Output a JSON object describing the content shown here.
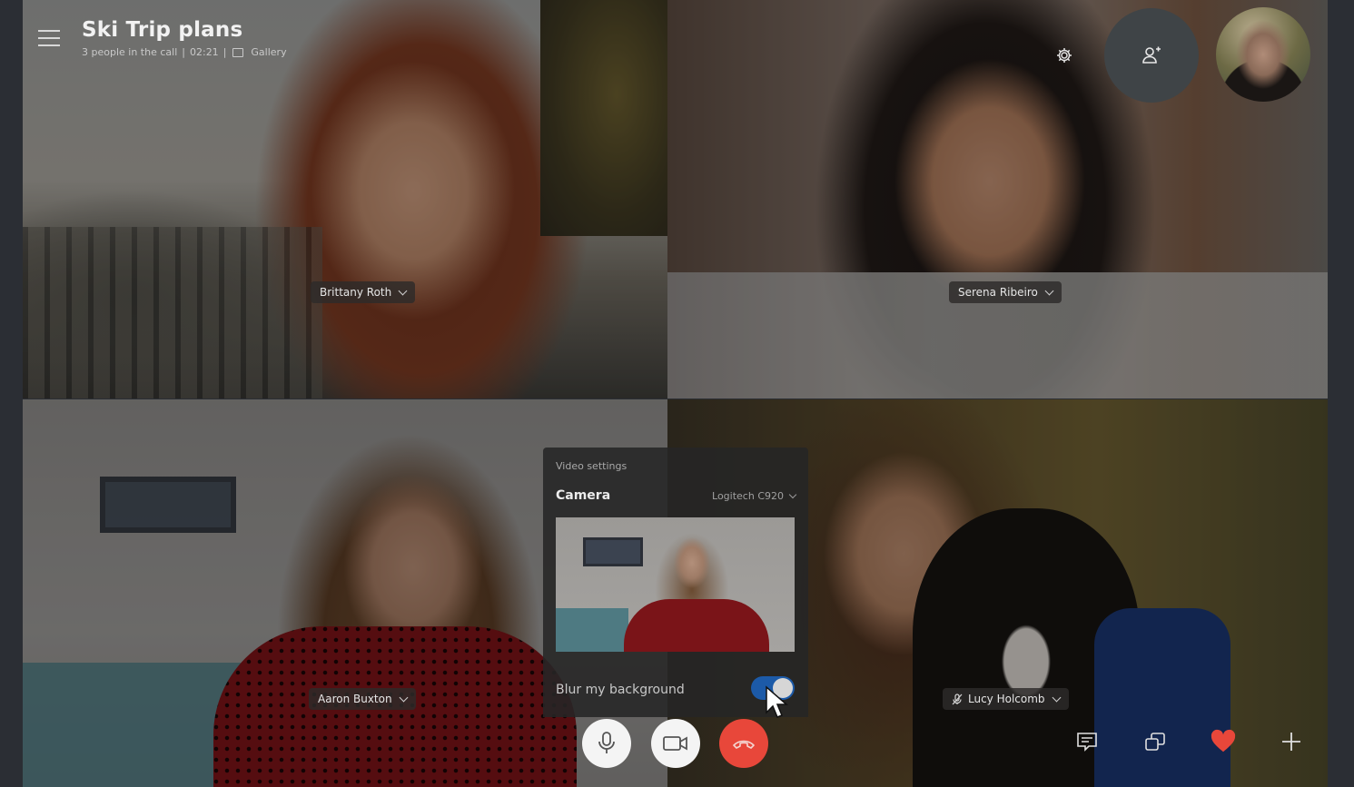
{
  "header": {
    "title": "Ski Trip plans",
    "participants": "3 people in the call",
    "separator": "|",
    "duration": "02:21",
    "view_mode": "Gallery",
    "menu_icon": "hamburger-menu-icon"
  },
  "top_right": {
    "settings_icon": "gear-icon",
    "add_people_icon": "add-person-icon",
    "self_view": "self-view-avatar"
  },
  "participants": [
    {
      "name": "Brittany Roth",
      "muted": false
    },
    {
      "name": "Serena Ribeiro",
      "muted": false
    },
    {
      "name": "Aaron Buxton",
      "muted": false
    },
    {
      "name": "Lucy Holcomb",
      "muted": true
    }
  ],
  "video_settings": {
    "title": "Video settings",
    "camera_label": "Camera",
    "camera_device": "Logitech C920",
    "blur_label": "Blur my background",
    "blur_enabled": true
  },
  "controls": {
    "mic": "microphone-icon",
    "video": "video-camera-icon",
    "hangup": "end-call-icon",
    "chat": "chat-icon",
    "switch_view": "switch-view-icon",
    "react": "heart-icon",
    "more": "plus-icon"
  },
  "colors": {
    "background": "#2b2e34",
    "hangup": "#e8473a",
    "toggle_on": "#1c5aa8",
    "heart": "#e8473a"
  }
}
